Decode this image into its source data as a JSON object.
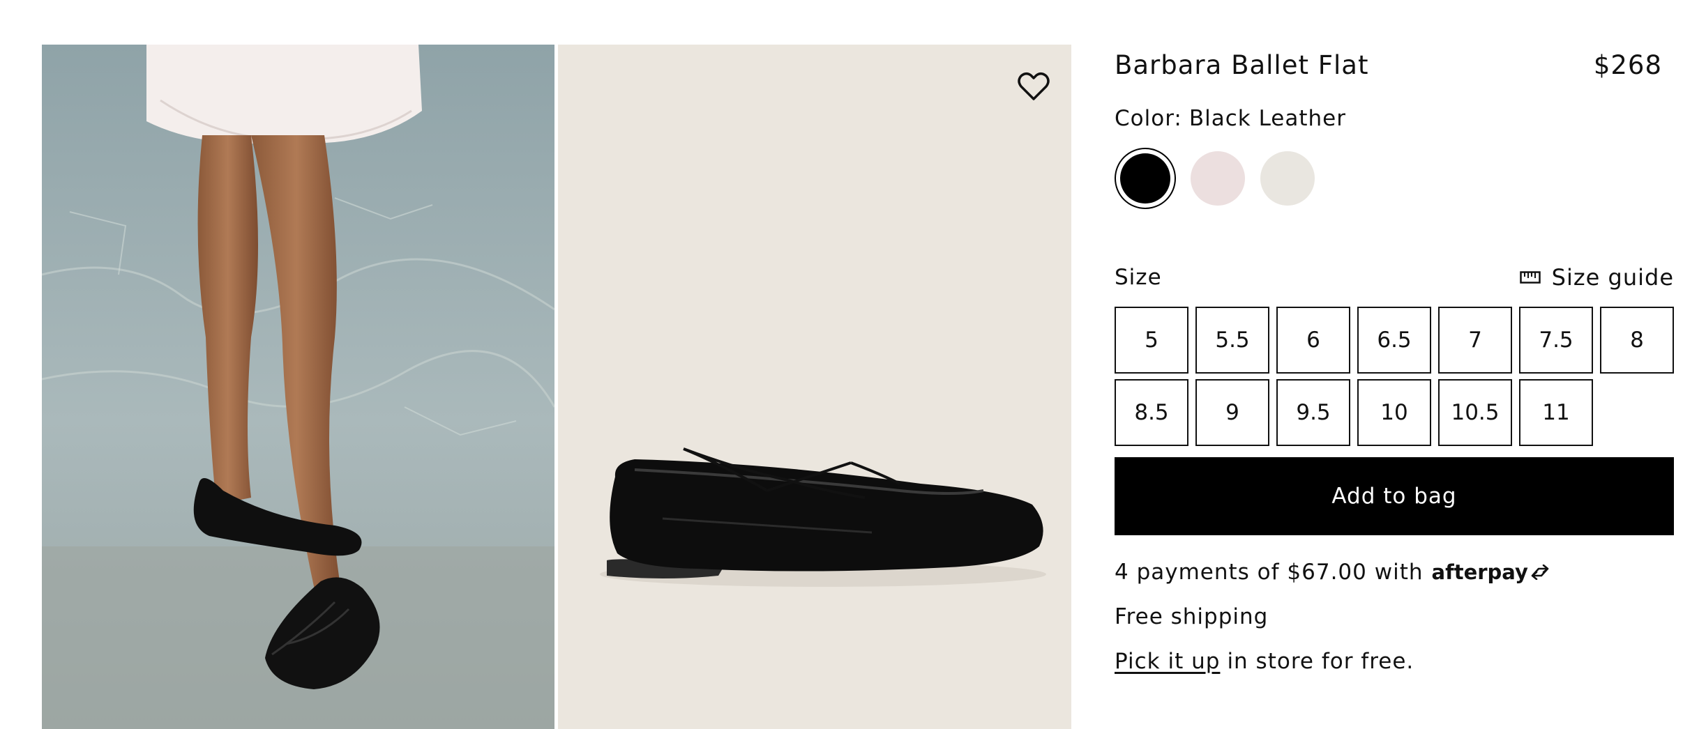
{
  "product": {
    "title": "Barbara Ballet Flat",
    "price": "$268"
  },
  "color": {
    "label": "Color:",
    "selected": "Black Leather",
    "swatches": [
      {
        "hex": "#000000",
        "selected": true
      },
      {
        "hex": "#ecdfdf",
        "selected": false
      },
      {
        "hex": "#e9e6e0",
        "selected": false
      }
    ]
  },
  "size": {
    "label": "Size",
    "guide_label": "Size guide",
    "options": [
      "5",
      "5.5",
      "6",
      "6.5",
      "7",
      "7.5",
      "8",
      "8.5",
      "9",
      "9.5",
      "10",
      "10.5",
      "11"
    ]
  },
  "actions": {
    "add_to_bag": "Add to bag"
  },
  "payment": {
    "text": "4 payments of $67.00 with",
    "provider": "afterpay"
  },
  "shipping": {
    "text": "Free shipping"
  },
  "pickup": {
    "link": "Pick it up",
    "text": "in store for free."
  },
  "icons": {
    "wishlist": "heart-icon",
    "size_guide": "ruler-icon",
    "afterpay": "afterpay-arrows-icon"
  }
}
